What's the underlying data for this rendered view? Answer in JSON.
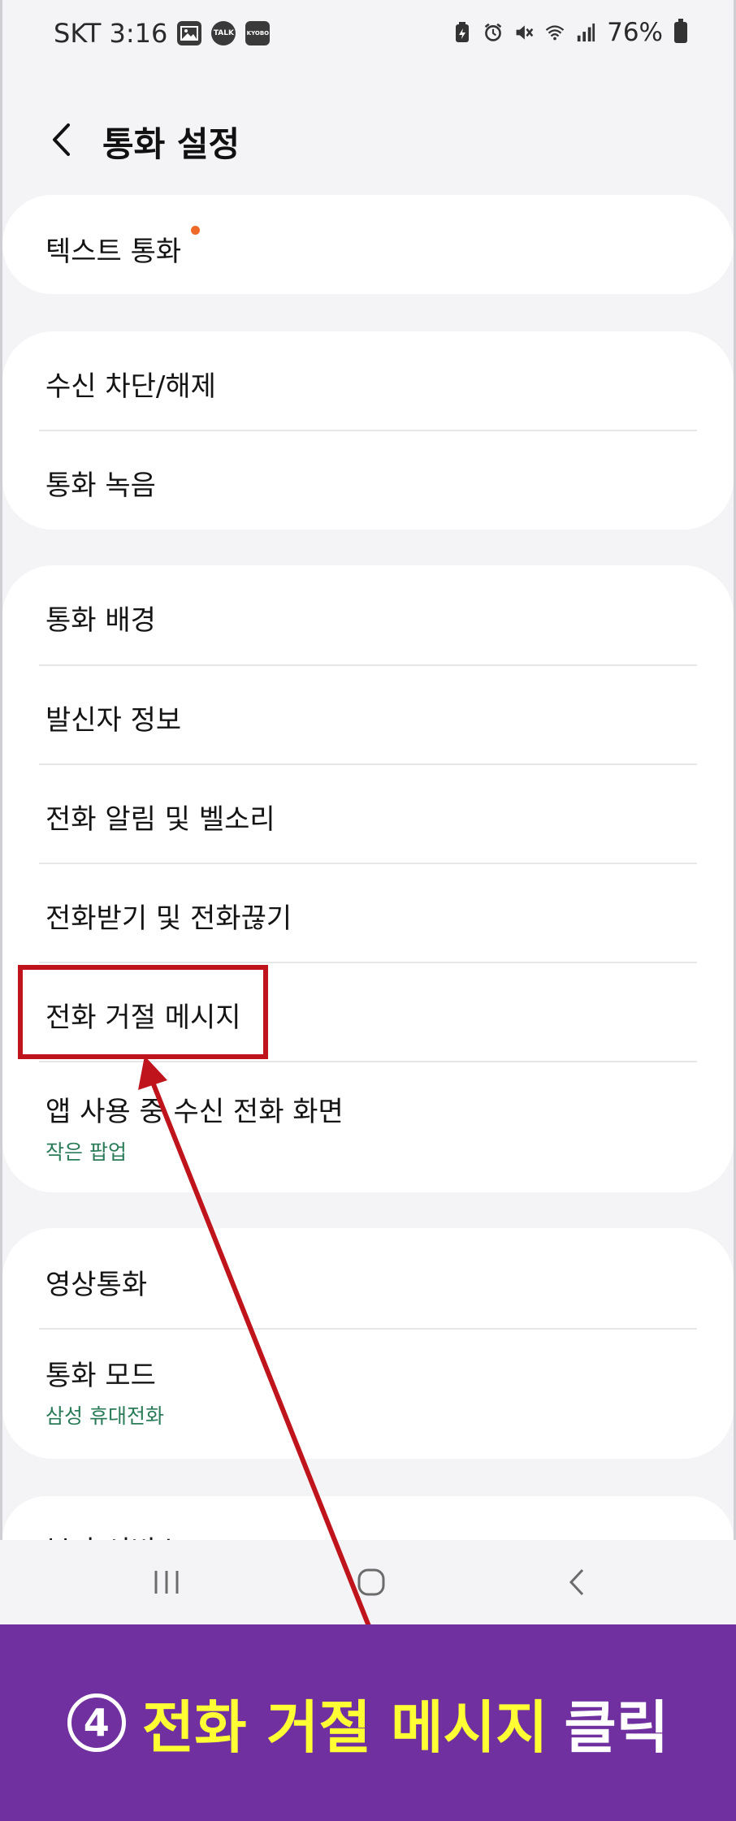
{
  "status_bar": {
    "carrier_time": "SKT 3:16",
    "notif_icons": [
      "image-icon",
      "kakaotalk-icon",
      "kyobo-icon"
    ],
    "talk_label": "TALK",
    "kyobo_label": "KYOBO",
    "system_icons": [
      "battery-saver-icon",
      "alarm-icon",
      "mute-icon",
      "wifi-icon",
      "signal-icon"
    ],
    "battery": "76%"
  },
  "header": {
    "title": "통화 설정",
    "back_icon": "chevron-left-icon"
  },
  "groups": [
    {
      "items": [
        {
          "label": "텍스트 통화",
          "badge": true
        }
      ]
    },
    {
      "items": [
        {
          "label": "수신 차단/해제"
        },
        {
          "label": "통화 녹음"
        }
      ]
    },
    {
      "items": [
        {
          "label": "통화 배경"
        },
        {
          "label": "발신자 정보"
        },
        {
          "label": "전화 알림 및 벨소리"
        },
        {
          "label": "전화받기 및 전화끊기"
        },
        {
          "label": "전화 거절 메시지"
        },
        {
          "label": "앱 사용 중 수신 전화 화면",
          "sub": "작은 팝업"
        }
      ]
    },
    {
      "items": [
        {
          "label": "영상통화"
        },
        {
          "label": "통화 모드",
          "sub": "삼성 휴대전화"
        }
      ]
    },
    {
      "items": [
        {
          "label": "부가 서비스"
        }
      ]
    }
  ],
  "nav": {
    "recents_icon": "recents-icon",
    "home_icon": "home-icon",
    "back_icon": "back-icon"
  },
  "annotation": {
    "highlighted_item": "전화 거절 메시지",
    "color": "#c0141c"
  },
  "caption": {
    "step": "4",
    "highlight": "전화 거절 메시지",
    "action": "클릭",
    "background": "#7030a0",
    "highlight_color": "#ffff33"
  },
  "colors": {
    "accent_sub": "#2a7b57",
    "badge": "#ef6a28"
  }
}
